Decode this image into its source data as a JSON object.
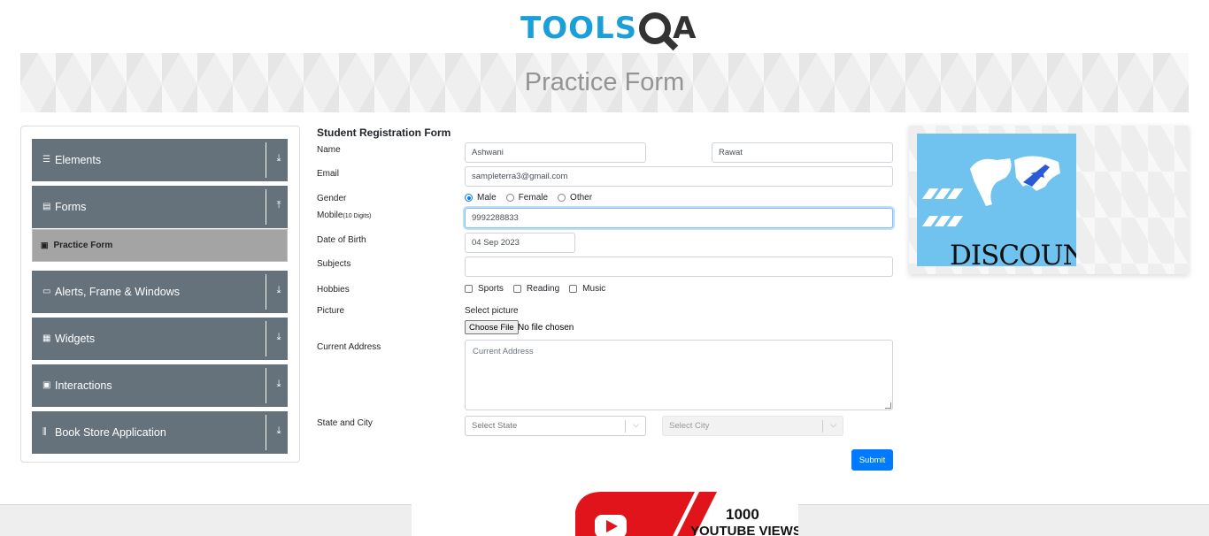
{
  "logo": {
    "text_a": "TOOLS",
    "text_b": "A"
  },
  "page_title": "Practice Form",
  "sidebar": {
    "groups": [
      {
        "label": "Elements",
        "icon": "list-icon",
        "arrow": "download-arrow-icon"
      },
      {
        "label": "Forms",
        "icon": "form-icon",
        "arrow": "upload-arrow-icon"
      },
      {
        "label": "Alerts, Frame & Windows",
        "icon": "window-icon",
        "arrow": "download-arrow-icon"
      },
      {
        "label": "Widgets",
        "icon": "widgets-icon",
        "arrow": "download-arrow-icon"
      },
      {
        "label": "Interactions",
        "icon": "interactions-icon",
        "arrow": "download-arrow-icon"
      },
      {
        "label": "Book Store Application",
        "icon": "books-icon",
        "arrow": "download-arrow-icon"
      }
    ],
    "active_item": "Practice Form"
  },
  "form": {
    "title": "Student Registration Form",
    "labels": {
      "name": "Name",
      "email": "Email",
      "gender": "Gender",
      "mobile": "Mobile",
      "mobile_hint": "(10 Digits)",
      "dob": "Date of Birth",
      "subjects": "Subjects",
      "hobbies": "Hobbies",
      "picture": "Picture",
      "address": "Current Address",
      "state_city": "State and City"
    },
    "first_name": "Ashwani",
    "last_name": "Rawat",
    "email": "sampleterra3@gmail.com",
    "gender_options": [
      "Male",
      "Female",
      "Other"
    ],
    "gender_selected": "Male",
    "mobile": "9992288833",
    "dob": "04 Sep 2023",
    "subjects": "",
    "hobbies": [
      "Sports",
      "Reading",
      "Music"
    ],
    "picture_label": "Select picture",
    "file_button": "Choose File",
    "file_status": "No file chosen",
    "address_placeholder": "Current Address",
    "state_placeholder": "Select State",
    "city_placeholder": "Select City",
    "submit": "Submit"
  },
  "ad_right": {
    "text": "DISCOUNT"
  },
  "ad_bottom": {
    "line1": "1000",
    "line2": "YOUTUBE VIEWS"
  },
  "colors": {
    "accent": "#007bff",
    "sidebar": "#65727c",
    "logo_blue": "#1b9fd8"
  }
}
